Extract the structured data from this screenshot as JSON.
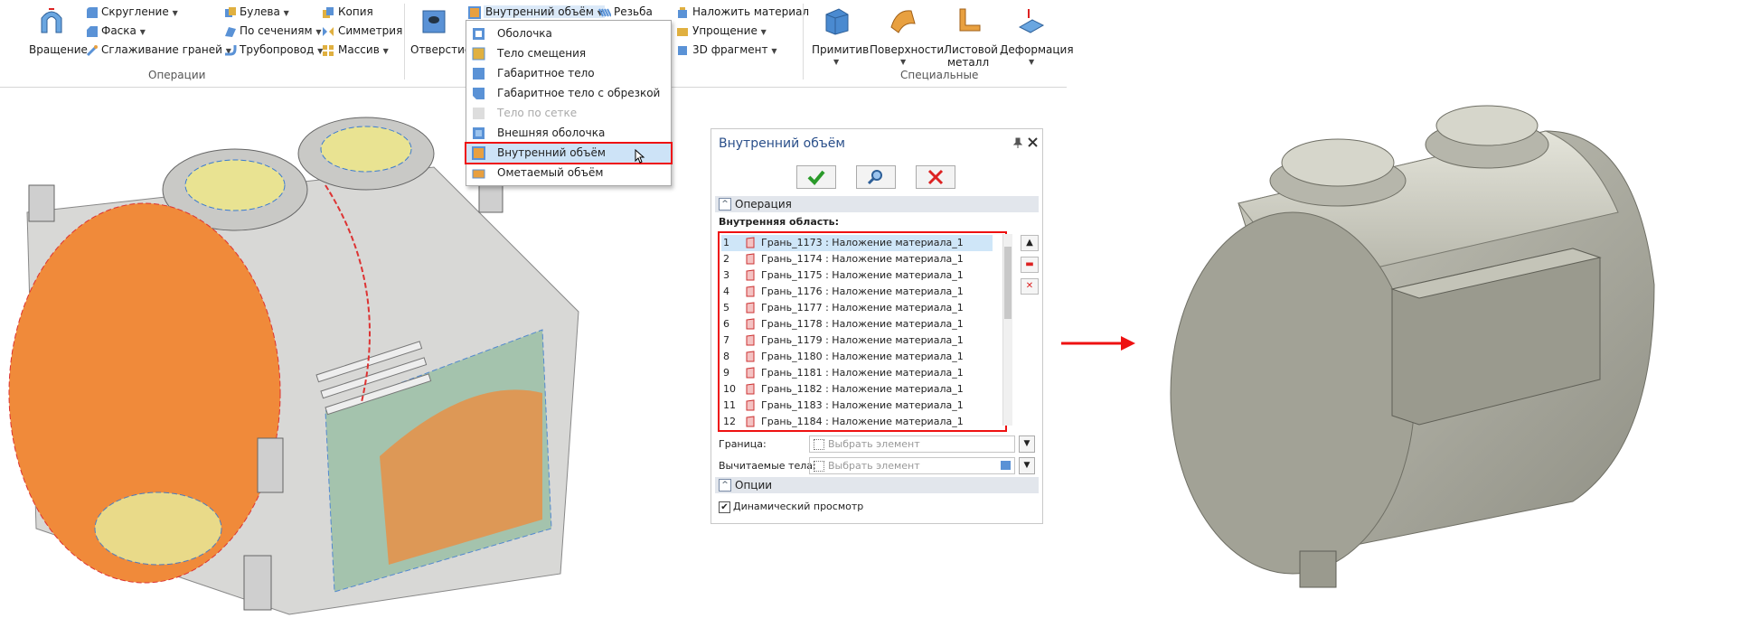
{
  "ribbon": {
    "operations_group_label": "Операции",
    "special_group_label": "Специальные",
    "rotation_label": "Вращение",
    "fillet_label": "Скругление",
    "chamfer_label": "Фаска",
    "edge_blend_label": "Сглаживание граней",
    "boolean_label": "Булева",
    "by_sections_label": "По сечениям",
    "pipeline_label": "Трубопровод",
    "copy_label": "Копия",
    "symmetry_label": "Симметрия",
    "array_label": "Массив",
    "hole_label": "Отверстие",
    "inner_volume_label": "Внутренний объём",
    "thread_label": "Резьба",
    "apply_material_label": "Наложить материал",
    "simplify_label": "Упрощение",
    "fragment_3d_label": "3D фрагмент",
    "primitive_label": "Примитив",
    "surfaces_label": "Поверхности",
    "sheet_metal_line1": "Листовой",
    "sheet_metal_line2": "металл",
    "deformation_label": "Деформация"
  },
  "menu": {
    "items": [
      {
        "label": "Оболочка",
        "enabled": true,
        "selected": false
      },
      {
        "label": "Тело смещения",
        "enabled": true,
        "selected": false
      },
      {
        "label": "Габаритное тело",
        "enabled": true,
        "selected": false
      },
      {
        "label": "Габаритное тело с обрезкой",
        "enabled": true,
        "selected": false
      },
      {
        "label": "Тело по сетке",
        "enabled": false,
        "selected": false
      },
      {
        "label": "Внешняя оболочка",
        "enabled": true,
        "selected": false
      },
      {
        "label": "Внутренний объём",
        "enabled": true,
        "selected": true
      },
      {
        "label": "Ометаемый объём",
        "enabled": true,
        "selected": false
      }
    ]
  },
  "dialog": {
    "title": "Внутренний объём",
    "operation_section": "Операция",
    "inner_region_label": "Внутренняя область:",
    "rows": [
      {
        "n": "1",
        "text": "Грань_1173 : Наложение материала_1"
      },
      {
        "n": "2",
        "text": "Грань_1174 : Наложение материала_1"
      },
      {
        "n": "3",
        "text": "Грань_1175 : Наложение материала_1"
      },
      {
        "n": "4",
        "text": "Грань_1176 : Наложение материала_1"
      },
      {
        "n": "5",
        "text": "Грань_1177 : Наложение материала_1"
      },
      {
        "n": "6",
        "text": "Грань_1178 : Наложение материала_1"
      },
      {
        "n": "7",
        "text": "Грань_1179 : Наложение материала_1"
      },
      {
        "n": "8",
        "text": "Грань_1180 : Наложение материала_1"
      },
      {
        "n": "9",
        "text": "Грань_1181 : Наложение материала_1"
      },
      {
        "n": "10",
        "text": "Грань_1182 : Наложение материала_1"
      },
      {
        "n": "11",
        "text": "Грань_1183 : Наложение материала_1"
      },
      {
        "n": "12",
        "text": "Грань_1184 : Наложение материала_1"
      }
    ],
    "boundary_label": "Граница:",
    "boundary_placeholder": "Выбрать элемент",
    "subtract_label": "Вычитаемые тела:",
    "subtract_placeholder": "Выбрать элемент",
    "options_section": "Опции",
    "dynamic_preview_label": "Динамический просмотр",
    "dynamic_preview_checked": true
  },
  "colors": {
    "highlight_red": "#e11111",
    "dialog_title": "#2a4f8a",
    "model_gray": "#a8a89c"
  }
}
